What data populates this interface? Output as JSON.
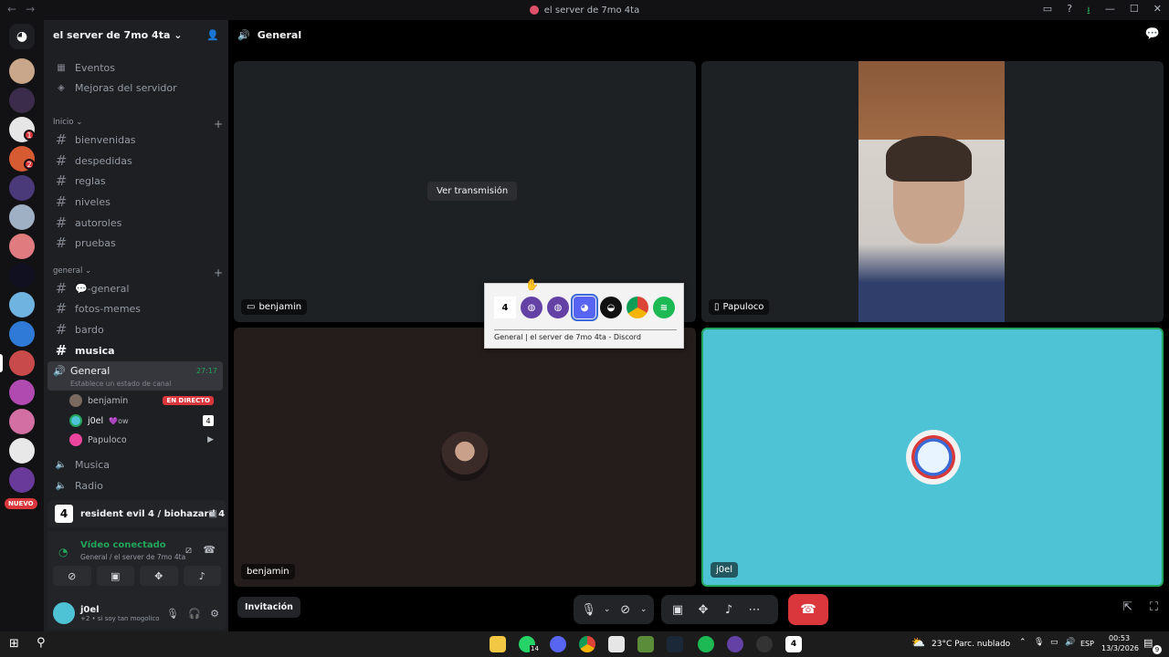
{
  "window": {
    "title": "el server de 7mo 4ta"
  },
  "server": {
    "name": "el server de 7mo 4ta"
  },
  "sidebar": {
    "top_items": [
      {
        "label": "Eventos"
      },
      {
        "label": "Mejoras del servidor"
      }
    ],
    "categories": [
      {
        "label": "Inicio"
      },
      {
        "label": "general"
      }
    ],
    "inicio_channels": [
      {
        "label": "bienvenidas"
      },
      {
        "label": "despedidas"
      },
      {
        "label": "reglas"
      },
      {
        "label": "niveles"
      },
      {
        "label": "autoroles"
      },
      {
        "label": "pruebas"
      }
    ],
    "general_channels": [
      {
        "label": "💬-general"
      },
      {
        "label": "fotos-memes"
      },
      {
        "label": "bardo"
      },
      {
        "label": "musica"
      }
    ],
    "active_voice": {
      "label": "General",
      "timer": "27:17",
      "status_hint": "Establece un estado de canal"
    },
    "voice_users": [
      {
        "name": "benjamin",
        "badge": "EN DIRECTO"
      },
      {
        "name": "j0el",
        "extra": "ow"
      },
      {
        "name": "Papuloco"
      }
    ],
    "other_voice": [
      {
        "label": "Musica"
      },
      {
        "label": "Radio"
      }
    ],
    "rail_new_badge": "NUEVO",
    "rail_badges": [
      "1",
      "2"
    ]
  },
  "activity": {
    "game": "resident evil 4 / biohazard 4"
  },
  "voice_status": {
    "title": "Vídeo conectado",
    "subtitle": "General / el server de 7mo 4ta"
  },
  "user_panel": {
    "name": "j0el",
    "status": "+2 • si soy tan mogolico"
  },
  "main": {
    "channel": "General",
    "watch_stream": "Ver transmisión",
    "tiles": [
      {
        "label": "benjamin"
      },
      {
        "label": "Papuloco"
      },
      {
        "label": "benjamin"
      },
      {
        "label": "j0el"
      }
    ],
    "invite_label": "Invitación"
  },
  "alt_tab": {
    "caption": "General | el server de 7mo 4ta - Discord",
    "icons": [
      "re4-icon",
      "twitch-icon",
      "twitch-icon",
      "discord-icon",
      "obs-icon",
      "chrome-icon",
      "spotify-icon"
    ]
  },
  "taskbar": {
    "weather": "23°C  Parc. nublado",
    "lang": "ESP",
    "time": "00:53",
    "date": "13/3/2026",
    "whatsapp_count": "14",
    "notif_count": "9"
  },
  "colors": {
    "accent_green": "#23a55a",
    "live_red": "#da373c",
    "tile_cyan": "#4ec3d6"
  }
}
